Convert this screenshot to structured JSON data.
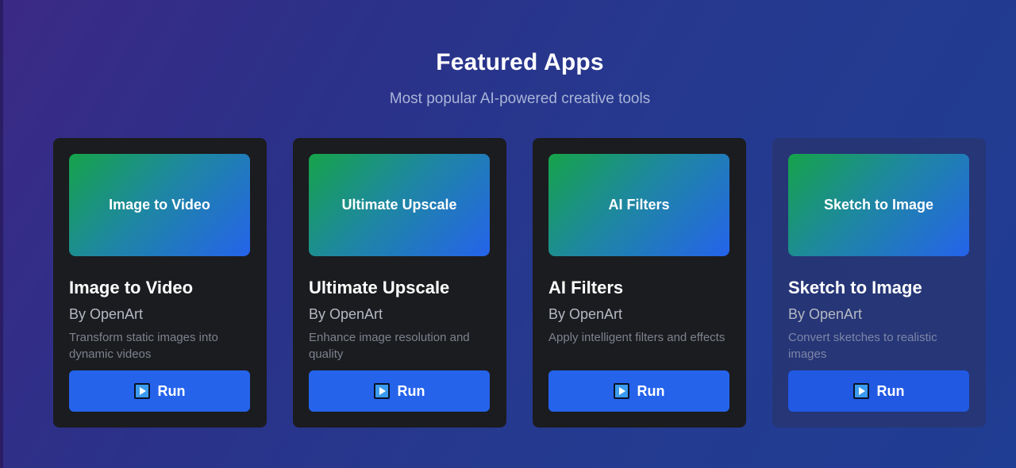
{
  "header": {
    "title": "Featured Apps",
    "subtitle": "Most popular AI-powered creative tools"
  },
  "apps": [
    {
      "thumb_label": "Image to Video",
      "title": "Image to Video",
      "author": "By OpenArt",
      "description": "Transform static images into dynamic videos",
      "button_label": "Run",
      "button_icon": "play-icon"
    },
    {
      "thumb_label": "Ultimate Upscale",
      "title": "Ultimate Upscale",
      "author": "By OpenArt",
      "description": "Enhance image resolution and quality",
      "button_label": "Run",
      "button_icon": "play-icon"
    },
    {
      "thumb_label": "AI Filters",
      "title": "AI Filters",
      "author": "By OpenArt",
      "description": "Apply intelligent filters and effects",
      "button_label": "Run",
      "button_icon": "play-icon"
    },
    {
      "thumb_label": "Sketch to Image",
      "title": "Sketch to Image",
      "author": "By OpenArt",
      "description": "Convert sketches to realistic images",
      "button_label": "Run",
      "button_icon": "play-icon"
    }
  ],
  "colors": {
    "accent": "#2563eb",
    "card_background": "#1b1c1f",
    "thumb_gradient_start": "#16a34a",
    "thumb_gradient_end": "#2563eb"
  }
}
